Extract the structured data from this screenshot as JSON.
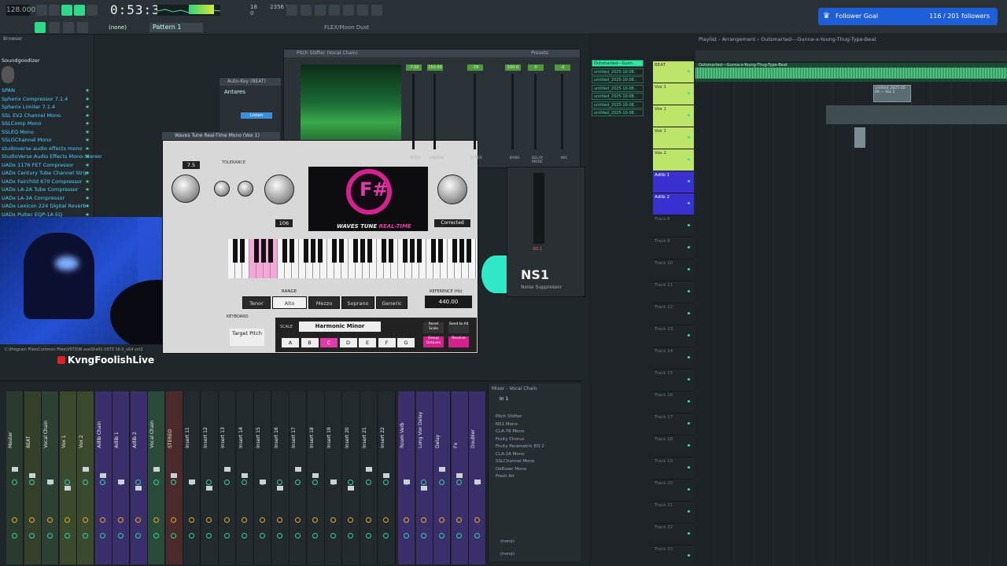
{
  "toolbar": {
    "tempo": "128.000",
    "time": "0:53:31",
    "pattern": "Pattern 1",
    "cpu": "18",
    "ram": "2356 MB",
    "voices": "0",
    "mode": "(none)",
    "project": "FLEX/Moon Dust"
  },
  "follower": {
    "label": "Follower Goal",
    "count": "116 / 201 followers"
  },
  "browser": {
    "title": "Browser",
    "current": "Soundgoodizer",
    "items": [
      "SPAN",
      "Spherix Compressor 7.1.4",
      "Spherix Limiter 7.1.4",
      "SSL EV2 Channel Mono",
      "SSLComp Mono",
      "SSLEQ Mono",
      "SSLGChannel Mono",
      "studioverse audio effects mono",
      "StudioVerse Audio Effects Mono-Stereo",
      "UADx 1176 FET Compressor",
      "UADx Century Tube Channel Strip",
      "UADx Fairchild 670 Compressor",
      "UADx LA-2A Tube Compressor",
      "UADx LA-3A Compressor",
      "UADx Lexicon 224 Digital Reverb",
      "UADx Pultec EQP-1A EQ"
    ]
  },
  "stream": {
    "streamer": "KvngFoolishLive",
    "path": "C:\\Program Files\\Common Files\\VST3\\W aveShell1-VST3 16.0_x64.vst3"
  },
  "autokey": {
    "title": "Auto-Key (BEAT)",
    "brand": "Antares",
    "listen": "Listen"
  },
  "pitch_shifter": {
    "title": "Pitch Shifter (Vocal Chain)",
    "presets": "Presets",
    "readouts": [
      "-7.00",
      "150.00",
      "-79",
      "100.0",
      "0",
      "-0"
    ],
    "labels": [
      "PITCH",
      "UNISON",
      "JITTER",
      "BAND",
      "DELAY MODE",
      "MIX"
    ]
  },
  "waves_tune": {
    "title": "Waves Tune Real-Time Mono (Vox 1)",
    "note": "F#",
    "logo_a": "WAVES TUNE",
    "logo_b": "REAL-TIME",
    "speed": "7.5",
    "tolerance_label": "TOLERANCE",
    "note_value": "106",
    "formant": "Corrected",
    "range_label": "RANGE",
    "range": [
      "Tenor",
      "Alto",
      "Mezzo Soprano",
      "Soprano",
      "Generic"
    ],
    "range_selected": "Alto",
    "reference_label": "REFERENCE (Hz)",
    "reference": "440.00",
    "scale_label": "SCALE",
    "scale": "Harmonic Minor",
    "notes": [
      "A",
      "B",
      "C",
      "D",
      "E",
      "F",
      "G"
    ],
    "note_selected": "C",
    "target": "Target Pitch",
    "reset": "Reset Scale",
    "send_all": "Send to All",
    "group": "Group Octaves",
    "receive": "Receive",
    "keyboard_label": "KEYBOARD"
  },
  "ns1": {
    "name": "NS1",
    "sub": "Noise Suppressor",
    "db": "-92.1"
  },
  "mixer": {
    "title": "Mixer - Vocal Chain",
    "strips": [
      "Master",
      "BEAT",
      "Vocal Chain",
      "Vox 1",
      "Vox 2",
      "Adlib Chain",
      "Adlib 1",
      "Adlib 2",
      "Vocal Chain",
      "STEREO",
      "Insert 11",
      "Insert 12",
      "Insert 13",
      "Insert 14",
      "Insert 15",
      "Insert 16",
      "Insert 17",
      "Insert 18",
      "Insert 19",
      "Insert 20",
      "Insert 21",
      "Insert 22",
      "Room Verb",
      "Long Vox Delay",
      "Delay",
      "Fx",
      "Doubler"
    ],
    "panel": {
      "input": "In 1",
      "slots": [
        "Pitch Shifter",
        "NS1 Mono",
        "CLA-76 Mono",
        "Fruity Chorus",
        "Fruity Parametric EQ 2",
        "CLA-2A Mono",
        "SSLChannel Mono",
        "DeEsser Mono",
        "Fresh Air"
      ],
      "out_a": "(none)",
      "out_b": "(none)"
    }
  },
  "playlist": {
    "title": "Playlist - Arrangement",
    "song": "Outsmarted---Gunna-x-Young-Thug-Type-Beat",
    "patterns": [
      "Outsmarted---Gunn..",
      "untitled_2025-10-08..",
      "untitled_2025-10-08..",
      "untitled_2025-10-08..",
      "untitled_2025-10-08..",
      "untitled_2025-10-08..",
      "untitled_2025-10-08.."
    ],
    "tracks": [
      "BEAT",
      "Vox 1",
      "Vox 1",
      "Vox 1",
      "Vox 2",
      "Adlib 1",
      "Adlib 2",
      "Track 8",
      "Track 9",
      "Track 10",
      "Track 11",
      "Track 12",
      "Track 13",
      "Track 14",
      "Track 15",
      "Track 16",
      "Track 17",
      "Track 18",
      "Track 19",
      "Track 20",
      "Track 21",
      "Track 22",
      "Track 23"
    ],
    "beat_clip": "Outsmarted---Gunna-x-Young-Thug-Type-Beat",
    "vox_clip": "untitled_2025-10-08 — Vox 2"
  }
}
